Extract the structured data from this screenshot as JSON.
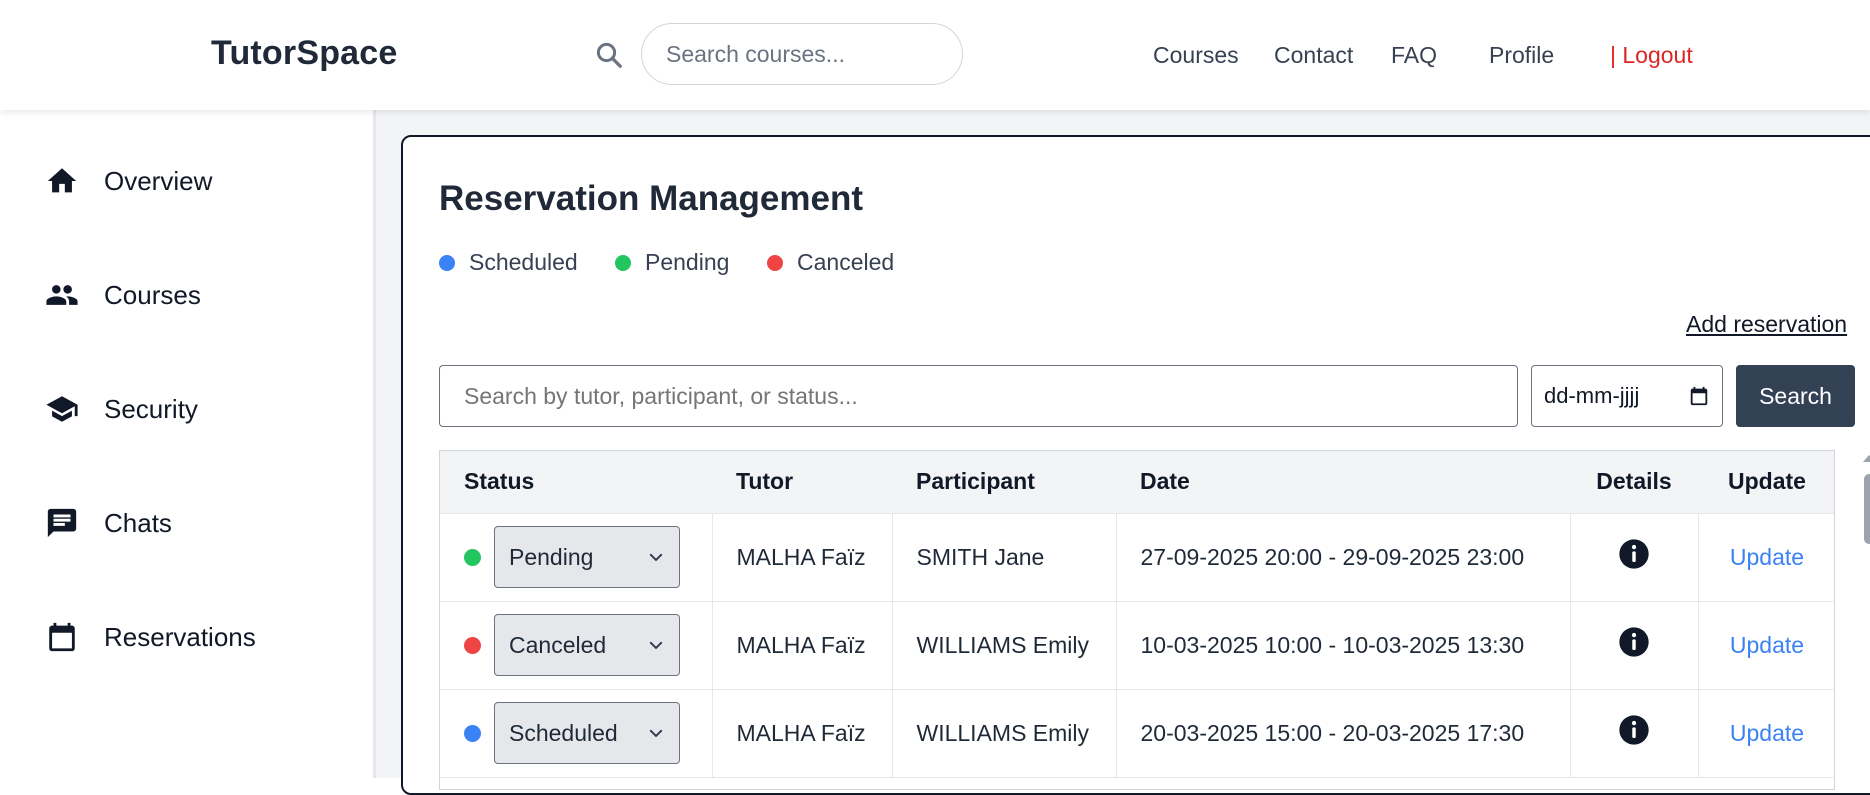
{
  "header": {
    "logo": "TutorSpace",
    "search_placeholder": "Search courses...",
    "nav": [
      "Courses",
      "Contact",
      "FAQ",
      "Profile",
      "| Logout"
    ]
  },
  "sidebar": {
    "items": [
      {
        "label": "Overview",
        "icon": "home-icon"
      },
      {
        "label": "Courses",
        "icon": "people-icon"
      },
      {
        "label": "Security",
        "icon": "graduation-cap-icon"
      },
      {
        "label": "Chats",
        "icon": "chat-icon"
      },
      {
        "label": "Reservations",
        "icon": "calendar-icon"
      }
    ]
  },
  "main": {
    "title": "Reservation Management",
    "legend": [
      {
        "label": "Scheduled",
        "color": "#3b82f6"
      },
      {
        "label": "Pending",
        "color": "#22c55e"
      },
      {
        "label": "Canceled",
        "color": "#ef4444"
      }
    ],
    "add_reservation": "Add reservation",
    "filter_placeholder": "Search by tutor, participant, or status...",
    "date_placeholder": "dd-mm-jjjj",
    "search_button": "Search",
    "table": {
      "columns": [
        "Status",
        "Tutor",
        "Participant",
        "Date",
        "Details",
        "Update"
      ],
      "rows": [
        {
          "status": "Pending",
          "status_color": "#22c55e",
          "tutor": "MALHA Faïz",
          "participant": "SMITH Jane",
          "date": "27-09-2025 20:00 - 29-09-2025 23:00",
          "update": "Update"
        },
        {
          "status": "Canceled",
          "status_color": "#ef4444",
          "tutor": "MALHA Faïz",
          "participant": "WILLIAMS Emily",
          "date": "10-03-2025 10:00 - 10-03-2025 13:30",
          "update": "Update"
        },
        {
          "status": "Scheduled",
          "status_color": "#3b82f6",
          "tutor": "MALHA Faïz",
          "participant": "WILLIAMS Emily",
          "date": "20-03-2025 15:00 - 20-03-2025 17:30",
          "update": "Update"
        }
      ]
    }
  }
}
